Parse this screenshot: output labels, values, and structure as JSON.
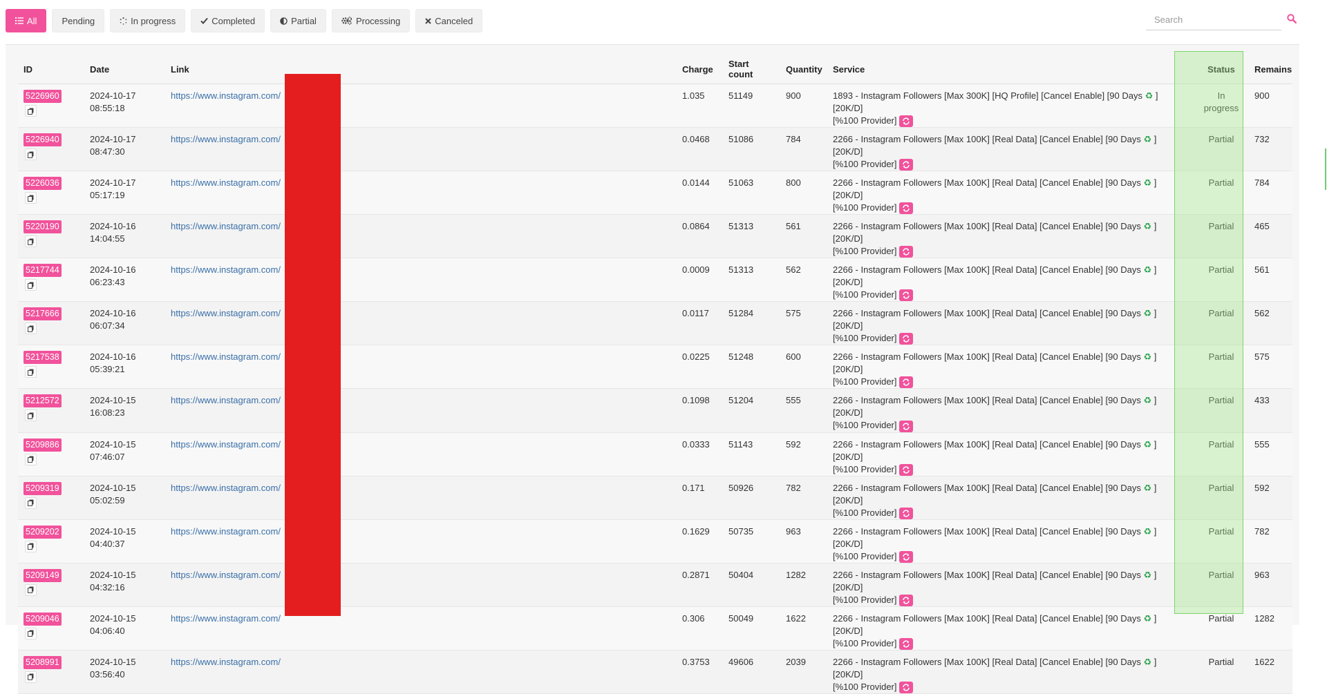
{
  "filters": [
    {
      "label": "All",
      "icon": "list-icon",
      "active": true
    },
    {
      "label": "Pending",
      "icon": "",
      "active": false
    },
    {
      "label": "In progress",
      "icon": "spinner-icon",
      "active": false
    },
    {
      "label": "Completed",
      "icon": "check-icon",
      "active": false
    },
    {
      "label": "Partial",
      "icon": "half-circle-icon",
      "active": false
    },
    {
      "label": "Processing",
      "icon": "gears-icon",
      "active": false
    },
    {
      "label": "Canceled",
      "icon": "x-icon",
      "active": false
    }
  ],
  "search": {
    "placeholder": "Search",
    "value": ""
  },
  "table": {
    "headers": {
      "id": "ID",
      "date": "Date",
      "link": "Link",
      "charge": "Charge",
      "start_count": "Start count",
      "quantity": "Quantity",
      "service": "Service",
      "status": "Status",
      "remains": "Remains"
    },
    "rows": [
      {
        "id": "5226960",
        "date": "2024-10-17",
        "time": "08:55:18",
        "link": "https://www.instagram.com/",
        "charge": "1.035",
        "start_count": "51149",
        "quantity": "900",
        "service_a": "1893 - Instagram Followers [Max 300K] [HQ Profile] [Cancel Enable] [90 Days ",
        "service_b": " ] [20K/D]",
        "service_c": "[%100 Provider]",
        "status": "In progress",
        "remains": "900"
      },
      {
        "id": "5226940",
        "date": "2024-10-17",
        "time": "08:47:30",
        "link": "https://www.instagram.com/",
        "charge": "0.0468",
        "start_count": "51086",
        "quantity": "784",
        "service_a": "2266 - Instagram Followers [Max 100K] [Real Data] [Cancel Enable] [90 Days ",
        "service_b": " ] [20K/D]",
        "service_c": "[%100 Provider]",
        "status": "Partial",
        "remains": "732"
      },
      {
        "id": "5226036",
        "date": "2024-10-17",
        "time": "05:17:19",
        "link": "https://www.instagram.com/",
        "charge": "0.0144",
        "start_count": "51063",
        "quantity": "800",
        "service_a": "2266 - Instagram Followers [Max 100K] [Real Data] [Cancel Enable] [90 Days ",
        "service_b": " ] [20K/D]",
        "service_c": "[%100 Provider]",
        "status": "Partial",
        "remains": "784"
      },
      {
        "id": "5220190",
        "date": "2024-10-16",
        "time": "14:04:55",
        "link": "https://www.instagram.com/",
        "charge": "0.0864",
        "start_count": "51313",
        "quantity": "561",
        "service_a": "2266 - Instagram Followers [Max 100K] [Real Data] [Cancel Enable] [90 Days ",
        "service_b": " ] [20K/D]",
        "service_c": "[%100 Provider]",
        "status": "Partial",
        "remains": "465"
      },
      {
        "id": "5217744",
        "date": "2024-10-16",
        "time": "06:23:43",
        "link": "https://www.instagram.com/",
        "charge": "0.0009",
        "start_count": "51313",
        "quantity": "562",
        "service_a": "2266 - Instagram Followers [Max 100K] [Real Data] [Cancel Enable] [90 Days ",
        "service_b": " ] [20K/D]",
        "service_c": "[%100 Provider]",
        "status": "Partial",
        "remains": "561"
      },
      {
        "id": "5217666",
        "date": "2024-10-16",
        "time": "06:07:34",
        "link": "https://www.instagram.com/",
        "charge": "0.0117",
        "start_count": "51284",
        "quantity": "575",
        "service_a": "2266 - Instagram Followers [Max 100K] [Real Data] [Cancel Enable] [90 Days ",
        "service_b": " ] [20K/D]",
        "service_c": "[%100 Provider]",
        "status": "Partial",
        "remains": "562"
      },
      {
        "id": "5217538",
        "date": "2024-10-16",
        "time": "05:39:21",
        "link": "https://www.instagram.com/",
        "charge": "0.0225",
        "start_count": "51248",
        "quantity": "600",
        "service_a": "2266 - Instagram Followers [Max 100K] [Real Data] [Cancel Enable] [90 Days ",
        "service_b": " ] [20K/D]",
        "service_c": "[%100 Provider]",
        "status": "Partial",
        "remains": "575"
      },
      {
        "id": "5212572",
        "date": "2024-10-15",
        "time": "16:08:23",
        "link": "https://www.instagram.com/",
        "charge": "0.1098",
        "start_count": "51204",
        "quantity": "555",
        "service_a": "2266 - Instagram Followers [Max 100K] [Real Data] [Cancel Enable] [90 Days ",
        "service_b": " ] [20K/D]",
        "service_c": "[%100 Provider]",
        "status": "Partial",
        "remains": "433"
      },
      {
        "id": "5209886",
        "date": "2024-10-15",
        "time": "07:46:07",
        "link": "https://www.instagram.com/",
        "charge": "0.0333",
        "start_count": "51143",
        "quantity": "592",
        "service_a": "2266 - Instagram Followers [Max 100K] [Real Data] [Cancel Enable] [90 Days ",
        "service_b": " ] [20K/D]",
        "service_c": "[%100 Provider]",
        "status": "Partial",
        "remains": "555"
      },
      {
        "id": "5209319",
        "date": "2024-10-15",
        "time": "05:02:59",
        "link": "https://www.instagram.com/",
        "charge": "0.171",
        "start_count": "50926",
        "quantity": "782",
        "service_a": "2266 - Instagram Followers [Max 100K] [Real Data] [Cancel Enable] [90 Days ",
        "service_b": " ] [20K/D]",
        "service_c": "[%100 Provider]",
        "status": "Partial",
        "remains": "592"
      },
      {
        "id": "5209202",
        "date": "2024-10-15",
        "time": "04:40:37",
        "link": "https://www.instagram.com/",
        "charge": "0.1629",
        "start_count": "50735",
        "quantity": "963",
        "service_a": "2266 - Instagram Followers [Max 100K] [Real Data] [Cancel Enable] [90 Days ",
        "service_b": " ] [20K/D]",
        "service_c": "[%100 Provider]",
        "status": "Partial",
        "remains": "782"
      },
      {
        "id": "5209149",
        "date": "2024-10-15",
        "time": "04:32:16",
        "link": "https://www.instagram.com/",
        "charge": "0.2871",
        "start_count": "50404",
        "quantity": "1282",
        "service_a": "2266 - Instagram Followers [Max 100K] [Real Data] [Cancel Enable] [90 Days ",
        "service_b": " ] [20K/D]",
        "service_c": "[%100 Provider]",
        "status": "Partial",
        "remains": "963"
      },
      {
        "id": "5209046",
        "date": "2024-10-15",
        "time": "04:06:40",
        "link": "https://www.instagram.com/",
        "charge": "0.306",
        "start_count": "50049",
        "quantity": "1622",
        "service_a": "2266 - Instagram Followers [Max 100K] [Real Data] [Cancel Enable] [90 Days ",
        "service_b": " ] [20K/D]",
        "service_c": "[%100 Provider]",
        "status": "Partial",
        "remains": "1282"
      },
      {
        "id": "5208991",
        "date": "2024-10-15",
        "time": "03:56:40",
        "link": "https://www.instagram.com/",
        "charge": "0.3753",
        "start_count": "49606",
        "quantity": "2039",
        "service_a": "2266 - Instagram Followers [Max 100K] [Real Data] [Cancel Enable] [90 Days ",
        "service_b": " ] [20K/D]",
        "service_c": "[%100 Provider]",
        "status": "Partial",
        "remains": "1622"
      }
    ]
  },
  "icons": {
    "copy": "copy-icon",
    "refill": "refill-icon",
    "recycle": "recycle-icon",
    "search": "search-icon"
  },
  "colors": {
    "accent": "#f1529b",
    "link": "#3a6fa8",
    "redaction": "#e41e1e",
    "status_highlight": "#7ad66a",
    "recycle": "#2aa44a"
  }
}
